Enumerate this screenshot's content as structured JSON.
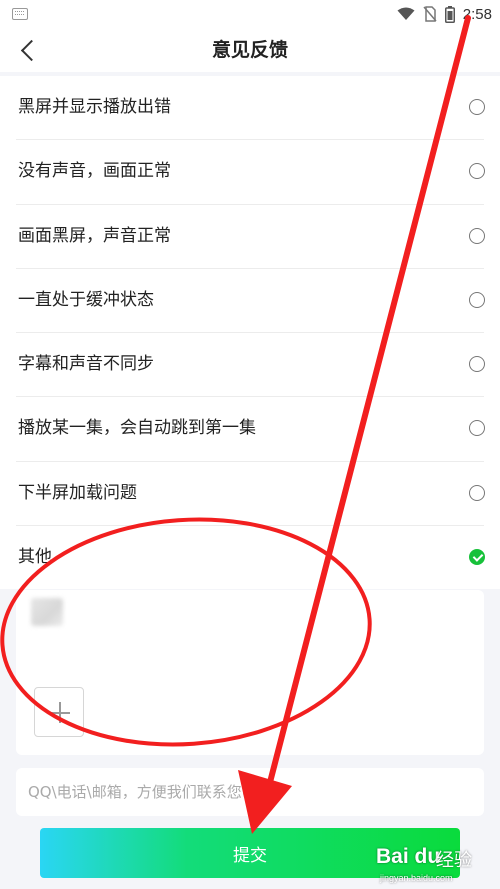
{
  "status_bar": {
    "time": "2:58",
    "icons": [
      "keyboard-icon",
      "wifi-icon",
      "no-sim-icon",
      "battery-icon"
    ]
  },
  "header": {
    "title": "意见反馈",
    "back_icon": "back-arrow-icon"
  },
  "options": [
    {
      "label": "黑屏并显示播放出错",
      "checked": false
    },
    {
      "label": "没有声音，画面正常",
      "checked": false
    },
    {
      "label": "画面黑屏，声音正常",
      "checked": false
    },
    {
      "label": "一直处于缓冲状态",
      "checked": false
    },
    {
      "label": "字幕和声音不同步",
      "checked": false
    },
    {
      "label": "播放某一集，会自动跳到第一集",
      "checked": false
    },
    {
      "label": "下半屏加载问题",
      "checked": false
    },
    {
      "label": "其他",
      "checked": true
    }
  ],
  "feedback": {
    "add_image_icon": "plus-icon"
  },
  "contact": {
    "placeholder": "QQ\\电话\\邮箱，方便我们联系您(选填)"
  },
  "submit": {
    "label": "提交"
  },
  "colors": {
    "accent_green": "#17c13a",
    "annotation_red": "#f21f1f",
    "gradient_start": "#2ad6f4",
    "gradient_end": "#0adb3c"
  },
  "watermark": {
    "logo": "Bai du",
    "brand": "经验",
    "url": "jingyan.baidu.com"
  }
}
